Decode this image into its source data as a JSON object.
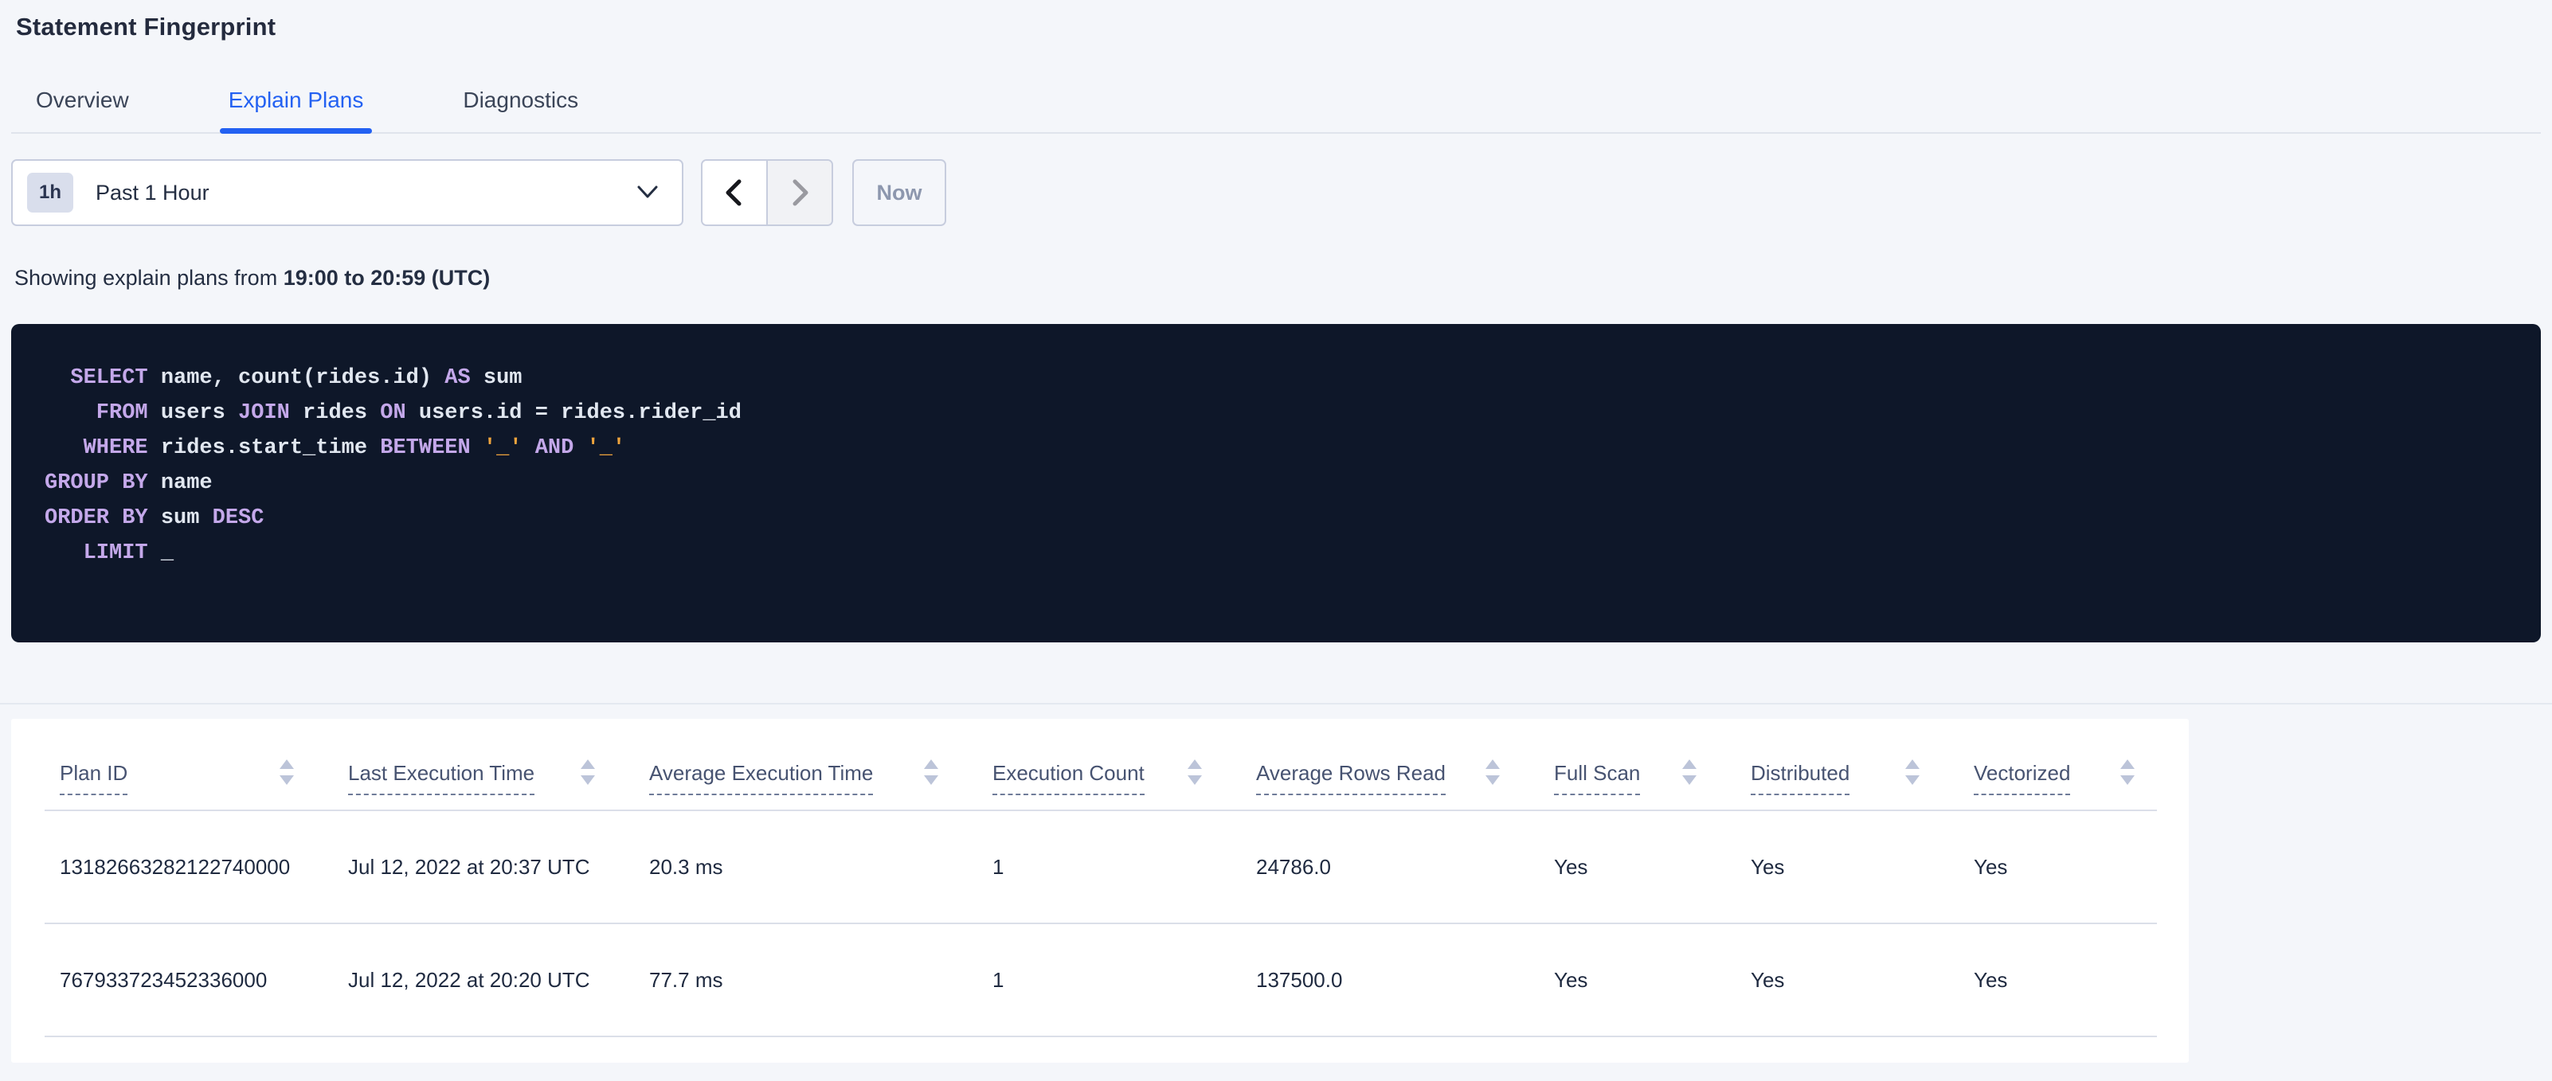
{
  "colors": {
    "accent_blue": "#2361f2",
    "code_bg": "#0e1729",
    "sql_keyword": "#c4a8ea",
    "sql_plain": "#e1e7f0",
    "sql_string": "#efa43d"
  },
  "page": {
    "title": "Statement Fingerprint"
  },
  "tabs": {
    "items": [
      {
        "label": "Overview",
        "active": false
      },
      {
        "label": "Explain Plans",
        "active": true
      },
      {
        "label": "Diagnostics",
        "active": false
      }
    ]
  },
  "time_picker": {
    "badge": "1h",
    "label": "Past 1 Hour",
    "dropdown_icon": "chevron-down",
    "prev_icon": "chevron-left",
    "next_icon": "chevron-right",
    "now_label": "Now"
  },
  "summary": {
    "prefix": "Showing explain plans from ",
    "range_bold": "19:00 to 20:59 (UTC)"
  },
  "sql": {
    "lines": [
      [
        {
          "t": "  SELECT",
          "c": "kw"
        },
        {
          "t": " name, count(rides.id) ",
          "c": "pl"
        },
        {
          "t": "AS",
          "c": "kw"
        },
        {
          "t": " sum",
          "c": "pl"
        }
      ],
      [
        {
          "t": "    FROM",
          "c": "kw"
        },
        {
          "t": " users ",
          "c": "pl"
        },
        {
          "t": "JOIN",
          "c": "kw"
        },
        {
          "t": " rides ",
          "c": "pl"
        },
        {
          "t": "ON",
          "c": "kw"
        },
        {
          "t": " users.id = rides.rider_id",
          "c": "pl"
        }
      ],
      [
        {
          "t": "   WHERE",
          "c": "kw"
        },
        {
          "t": " rides.start_time ",
          "c": "pl"
        },
        {
          "t": "BETWEEN",
          "c": "kw"
        },
        {
          "t": " ",
          "c": "pl"
        },
        {
          "t": "'_'",
          "c": "str"
        },
        {
          "t": " ",
          "c": "pl"
        },
        {
          "t": "AND",
          "c": "kw"
        },
        {
          "t": " ",
          "c": "pl"
        },
        {
          "t": "'_'",
          "c": "str"
        }
      ],
      [
        {
          "t": "GROUP BY",
          "c": "kw"
        },
        {
          "t": " name",
          "c": "pl"
        }
      ],
      [
        {
          "t": "ORDER BY",
          "c": "kw"
        },
        {
          "t": " sum ",
          "c": "pl"
        },
        {
          "t": "DESC",
          "c": "kw"
        }
      ],
      [
        {
          "t": "   LIMIT",
          "c": "kw"
        },
        {
          "t": " _",
          "c": "pl"
        }
      ]
    ]
  },
  "table": {
    "headers": [
      {
        "label": "Plan ID"
      },
      {
        "label": "Last Execution Time"
      },
      {
        "label": "Average Execution Time"
      },
      {
        "label": "Execution Count"
      },
      {
        "label": "Average Rows Read"
      },
      {
        "label": "Full Scan"
      },
      {
        "label": "Distributed"
      },
      {
        "label": "Vectorized"
      }
    ],
    "rows": [
      [
        "13182663282122740000",
        "Jul 12, 2022 at 20:37 UTC",
        "20.3 ms",
        "1",
        "24786.0",
        "Yes",
        "Yes",
        "Yes"
      ],
      [
        "767933723452336000",
        "Jul 12, 2022 at 20:20 UTC",
        "77.7 ms",
        "1",
        "137500.0",
        "Yes",
        "Yes",
        "Yes"
      ]
    ]
  }
}
